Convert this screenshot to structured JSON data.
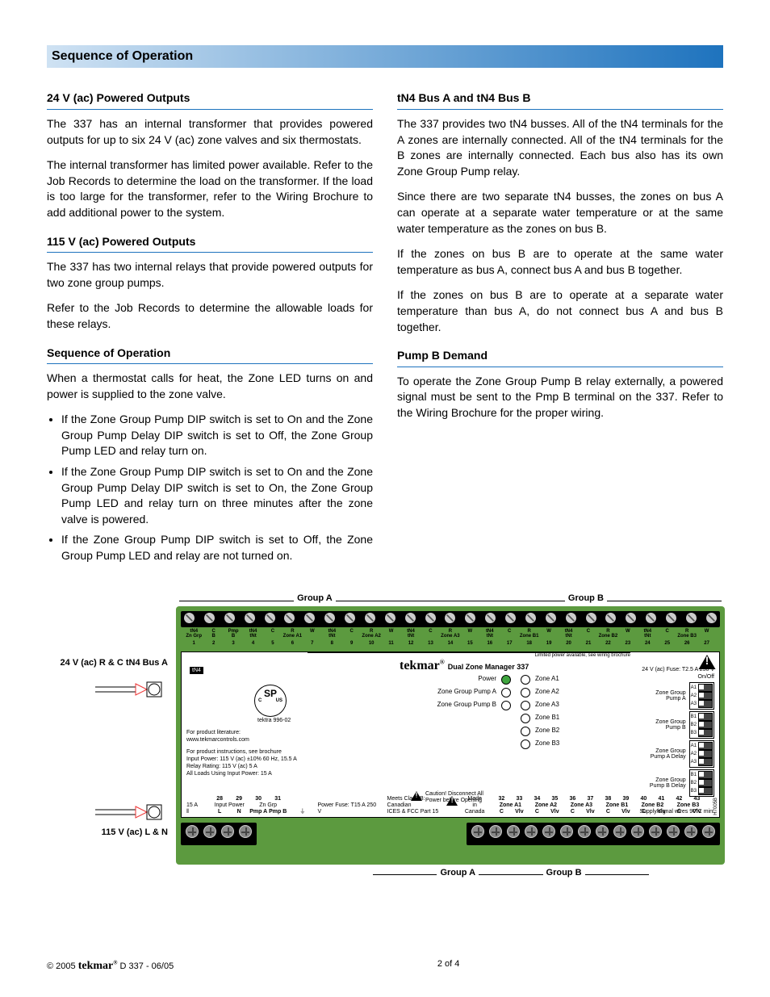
{
  "main_header": "Sequence of Operation",
  "left_column": {
    "h1": "24 V (ac) Powered Outputs",
    "p1": "The 337 has an internal transformer that provides powered outputs for up to six 24 V (ac) zone valves and six thermostats.",
    "p2": "The internal transformer has limited power available. Refer to the Job Records to determine the load on the transformer. If the load is too large for the transformer, refer to the Wiring Brochure to add additional power to the system.",
    "h2": "115 V (ac) Powered Outputs",
    "p3": "The 337 has two internal relays that provide powered outputs for two zone group pumps.",
    "p4": "Refer to the Job Records to determine the allowable loads for these relays.",
    "h3": "Sequence of Operation",
    "p5": "When a thermostat calls for heat, the Zone LED turns on and power is supplied to the zone valve.",
    "bullets": [
      "If the Zone Group Pump DIP switch is set to On and the Zone Group Pump Delay DIP switch is set to Off, the Zone Group Pump LED and relay turn on.",
      "If the Zone Group Pump DIP switch is set to On and the Zone Group Pump Delay DIP switch is set to On, the Zone Group Pump LED and relay turn on three minutes after the zone valve is powered.",
      "If the Zone Group Pump DIP switch is set to Off, the Zone Group Pump LED and relay are not turned on."
    ]
  },
  "right_column": {
    "h1": "tN4 Bus A and tN4 Bus B",
    "p1": "The 337 provides two tN4 busses. All of the tN4 terminals for the A zones are internally connected. All of the tN4 terminals for the B zones are internally connected. Each bus also has its own Zone Group Pump relay.",
    "p2": "Since there are two separate tN4 busses, the zones on bus A can operate at a separate water temperature or at the same water temperature as the zones on bus B.",
    "p3": "If the zones on bus B are to operate at the same water temperature as bus A, connect bus A and bus B together.",
    "p4": "If the zones on bus B are to operate at a separate water temperature than bus A, do not connect bus A and bus B together.",
    "h2": "Pump B Demand",
    "p5": "To operate the Zone Group Pump B relay externally, a powered signal must be sent to the Pmp B terminal on the 337. Refer to the Wiring Brochure for the proper wiring."
  },
  "diagram": {
    "group_a": "Group A",
    "group_b": "Group B",
    "side_top": "24 V (ac) R & C\ntN4 Bus A",
    "side_bottom": "115 V (ac) L & N",
    "top_terminal_labels": [
      "tN4\nZn Grp",
      "C\nB",
      "Pmp\nB",
      "tN4\ntNt",
      "C\n",
      "R\nZone A1",
      "W\n",
      "tN4\ntNt",
      "C\n",
      "R\nZone A2",
      "W\n",
      "tN4\ntNt",
      "C\n",
      "R\nZone A3",
      "W\n",
      "tN4\ntNt",
      "C\n",
      "R\nZone B1",
      "W\n",
      "tN4\ntNt",
      "C\n",
      "R\nZone B2",
      "W\n",
      "tN4\ntNt",
      "C\n",
      "R\nZone B3",
      "W\n"
    ],
    "top_terminal_nums": [
      "1",
      "2",
      "3",
      "4",
      "5",
      "6",
      "7",
      "8",
      "9",
      "10",
      "11",
      "12",
      "13",
      "14",
      "15",
      "16",
      "17",
      "18",
      "19",
      "20",
      "21",
      "22",
      "23",
      "24",
      "25",
      "26",
      "27"
    ],
    "limited": "Limited power available, see wiring brochure",
    "brand": "tekmar",
    "brand_sub": "Dual Zone Manager 337",
    "tn4_tag": "tN4",
    "su_mark_top": "SP",
    "su_mark_c": "C",
    "su_mark_us": "US",
    "tektra": "tektra 996-02",
    "prod_lit": "For product literature:\nwww.tekmarcontrols.com",
    "prod_inst1": "For product instructions, see brochure",
    "prod_inst2": "Input Power: 115 V (ac) ±10% 60 Hz, 15.5 A",
    "prod_inst3": "Relay Rating: 115 V (ac) 5 A",
    "prod_inst4": "All Loads Using Input Power: 15 A",
    "leds_left": [
      "Power",
      "Zone Group Pump A",
      "Zone Group Pump B"
    ],
    "leds_right": [
      "Zone A1",
      "Zone A2",
      "Zone A3",
      "Zone B1",
      "Zone B2",
      "Zone B3"
    ],
    "fuse_top": "24 V (ac) Fuse: T2.5 A 250 V",
    "onoff": "On/Off",
    "dip_groups": [
      {
        "label": "Zone Group\nPump A",
        "tags": [
          "A1",
          "A2",
          "A3"
        ]
      },
      {
        "label": "Zone Group\nPump B",
        "tags": [
          "B1",
          "B2",
          "B3"
        ]
      },
      {
        "label": "Zone Group\nPump A Delay",
        "tags": [
          "A1",
          "A2",
          "A3"
        ]
      },
      {
        "label": "Zone Group\nPump B Delay",
        "tags": [
          "B1",
          "B2",
          "B3"
        ]
      }
    ],
    "caution_text": "Caution! Disconnect All\nPower before Opening",
    "signal_note": "Supply/signal wires 90°C min.",
    "fifteenA": "15 A",
    "bottom_left_nums": [
      "28",
      "29",
      "30",
      "31"
    ],
    "bottom_left_labels_top": [
      "Input Power",
      "Zn Grp"
    ],
    "bottom_left_labels_bot": [
      "L",
      "N",
      "Pmp A",
      "Pmp B"
    ],
    "power_fuse": "Power Fuse: T15 A 250 V",
    "meets_class": "Meets Class B: Canadian\nICES & FCC Part 15",
    "made_in": "Made in\nCanada",
    "bottom_right_nums": [
      "32",
      "33",
      "34",
      "35",
      "36",
      "37",
      "38",
      "39",
      "40",
      "41",
      "42",
      "43"
    ],
    "bottom_right_zones": [
      "Zone A1",
      "Zone A2",
      "Zone A3",
      "Zone B1",
      "Zone B2",
      "Zone B3"
    ],
    "bottom_right_cvlv": [
      "C",
      "Vlv",
      "C",
      "Vlv",
      "C",
      "Vlv",
      "C",
      "Vlv",
      "C",
      "Vlv",
      "C",
      "Vlv"
    ],
    "side_code": "H7005B"
  },
  "footer": {
    "copyright": "© 2005",
    "brand": "tekmar",
    "doc": " D 337 - 06/05",
    "page": "2 of 4"
  }
}
